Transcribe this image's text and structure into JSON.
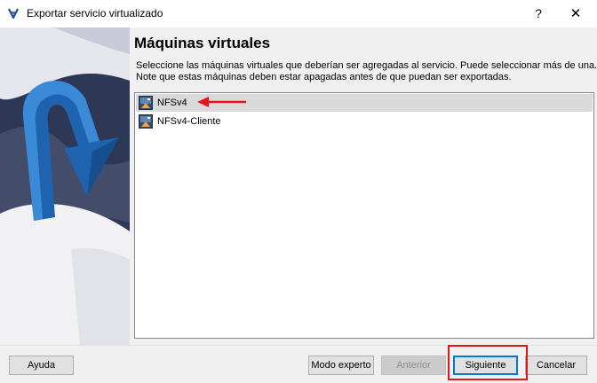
{
  "window": {
    "title": "Exportar servicio virtualizado",
    "help_label": "?",
    "close_label": "✕"
  },
  "main": {
    "heading": "Máquinas virtuales",
    "description_line1": "Seleccione las máquinas virtuales que deberían ser agregadas al servicio. Puede seleccionar más de una.",
    "description_line2": "Note que estas máquinas deben estar apagadas antes de que puedan ser exportadas."
  },
  "vm_list": {
    "items": [
      {
        "name": "NFSv4",
        "selected": true,
        "icon": "vm-icon"
      },
      {
        "name": "NFSv4-Cliente",
        "selected": false,
        "icon": "vm-icon"
      }
    ]
  },
  "buttons": {
    "help": "Ayuda",
    "expert_mode": "Modo experto",
    "back": "Anterior",
    "next": "Siguiente",
    "cancel": "Cancelar"
  },
  "colors": {
    "annotation": "#e3151a",
    "selection": "#d9d9d9",
    "focus": "#0078d7"
  }
}
